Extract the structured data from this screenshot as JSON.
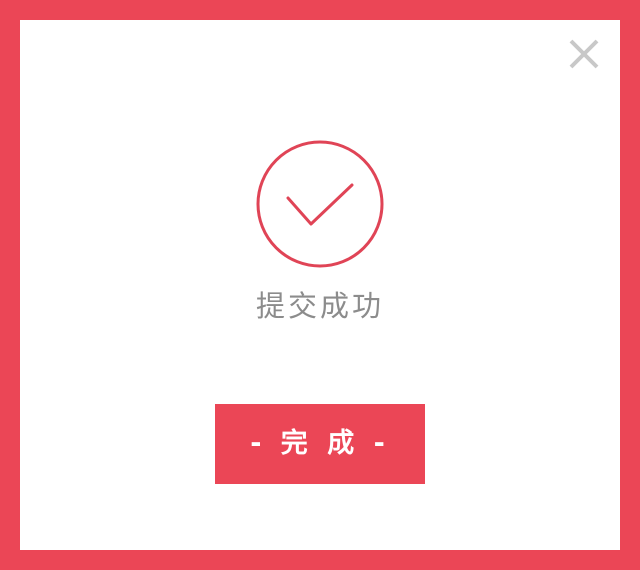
{
  "dialog": {
    "message": "提交成功",
    "done_label": "- 完 成 -",
    "close_icon": "close-icon",
    "success_icon": "checkmark-circle-icon"
  },
  "colors": {
    "accent": "#eb4656",
    "background": "#ffffff",
    "message_text": "#8c8c8c",
    "close_icon": "#c8c8c8"
  }
}
